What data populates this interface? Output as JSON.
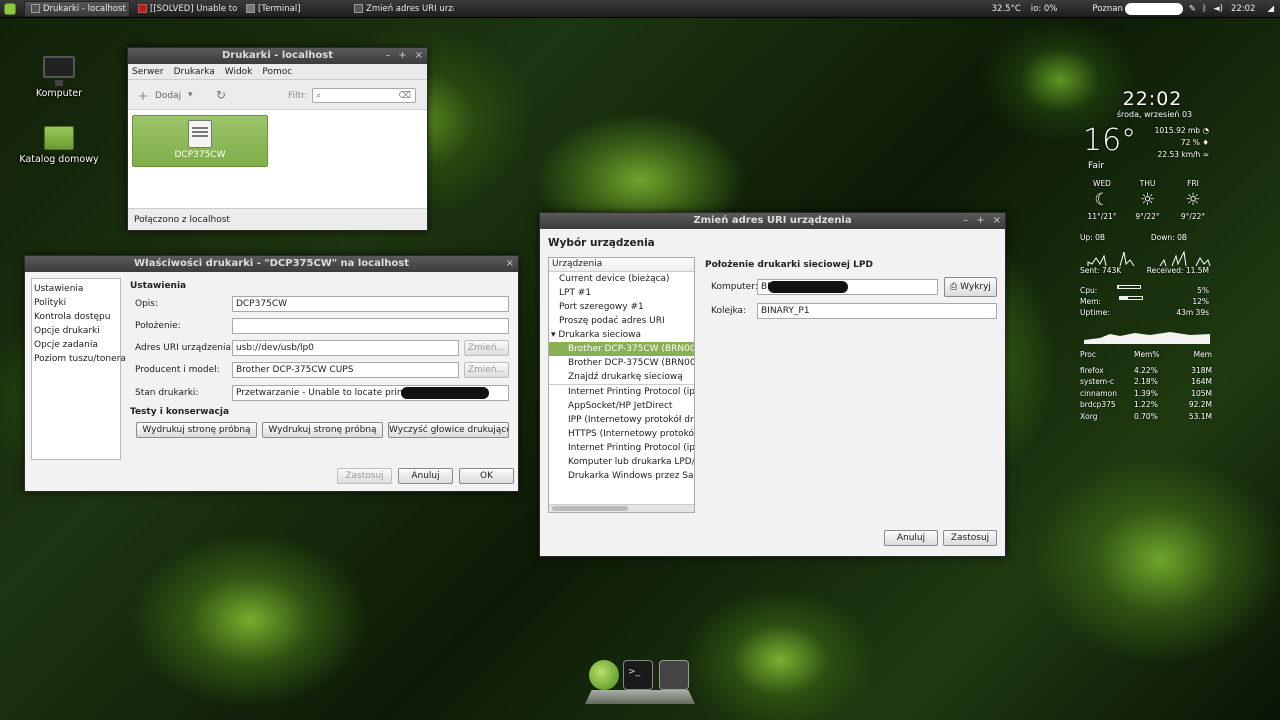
{
  "panel": {
    "tasks": [
      {
        "label": "Drukarki - localhost",
        "active": true
      },
      {
        "label": "[[SOLVED] Unable to ..."
      },
      {
        "label": "[Terminal]"
      },
      {
        "label": "Zmień adres URI urzą..."
      }
    ],
    "temp": "32.5°C",
    "io": "io: 0%",
    "city": "Poznan",
    "time": "22:02"
  },
  "desktop": {
    "computer_label": "Komputer",
    "home_label": "Katalog domowy"
  },
  "printers_window": {
    "title": "Drukarki - localhost",
    "menu": [
      "Serwer",
      "Drukarka",
      "Widok",
      "Pomoc"
    ],
    "add_label": "Dodaj",
    "filter_label": "Filtr:",
    "printer_name": "DCP375CW",
    "status": "Połączono z localhost"
  },
  "props_window": {
    "title": "Właściwości drukarki - \"DCP375CW\" na localhost",
    "sidebar": [
      "Ustawienia",
      "Polityki",
      "Kontrola dostępu",
      "Opcje drukarki",
      "Opcje zadania",
      "Poziom tuszu/tonera"
    ],
    "section_settings": "Ustawienia",
    "desc_label": "Opis:",
    "desc_value": "DCP375CW",
    "location_label": "Położenie:",
    "location_value": "",
    "uri_label": "Adres URI urządzenia:",
    "uri_value": "usb://dev/usb/lp0",
    "change_label": "Zmień...",
    "model_label": "Producent i model:",
    "model_value": "Brother DCP-375CW CUPS",
    "state_label": "Stan drukarki:",
    "state_value": "Przetwarzanie - Unable to locate printer \"",
    "section_tests": "Testy i konserwacja",
    "test_btn": "Wydrukuj stronę próbną",
    "clean_btn": "Wyczyść głowice drukujące",
    "apply": "Zastosuj",
    "cancel": "Anuluj",
    "ok": "OK"
  },
  "uri_window": {
    "title": "Zmień adres URI urządzenia",
    "heading": "Wybór urządzenia",
    "list_header": "Urządzenia",
    "items": [
      {
        "label": "Current device (bieżąca)",
        "indent": 1
      },
      {
        "label": "LPT #1",
        "indent": 1
      },
      {
        "label": "Port szeregowy #1",
        "indent": 1
      },
      {
        "label": "Proszę podać adres URI",
        "indent": 1
      },
      {
        "label": "Drukarka sieciowa",
        "indent": 0,
        "expander": true
      },
      {
        "label": "Brother DCP-375CW (BRN001B",
        "indent": 2,
        "selected": true
      },
      {
        "label": "Brother DCP-375CW (BRN001B",
        "indent": 2
      },
      {
        "label": "Znajdź drukarkę sieciową",
        "indent": 2
      },
      {
        "label": "Internet Printing Protocol (ipps",
        "indent": 2
      },
      {
        "label": "AppSocket/HP JetDirect",
        "indent": 2
      },
      {
        "label": "IPP (Internetowy protokół druk",
        "indent": 2
      },
      {
        "label": "HTTPS (Internetowy protokół dr",
        "indent": 2
      },
      {
        "label": "Internet Printing Protocol (ipp1",
        "indent": 2
      },
      {
        "label": "Komputer lub drukarka LPD/LP",
        "indent": 2
      },
      {
        "label": "Drukarka Windows przez Samb",
        "indent": 2
      }
    ],
    "detail_title": "Położenie drukarki sieciowej LPD",
    "host_label": "Komputer:",
    "host_value": "BR",
    "probe_btn": "Wykryj",
    "queue_label": "Kolejka:",
    "queue_value": "BINARY_P1",
    "cancel": "Anuluj",
    "apply": "Zastosuj"
  },
  "conky": {
    "clock": "22:02",
    "date": "środa, wrzesień 03",
    "temp": "16°",
    "condition": "Fair",
    "pressure": "1015.92 mb",
    "humidity": "72 %",
    "wind": "22.53 km/h",
    "forecast": [
      {
        "day": "WED",
        "range": "11°/21°",
        "icon": "moon-icon"
      },
      {
        "day": "THU",
        "range": "9°/22°",
        "icon": "sun-icon"
      },
      {
        "day": "FRI",
        "range": "9°/22°",
        "icon": "sun-icon"
      }
    ],
    "up_label": "Up: 0B",
    "down_label": "Down: 0B",
    "sent": "Sent: 743K",
    "received": "Received: 11.5M",
    "cpu_label": "Cpu:",
    "cpu_value": "5%",
    "cpu_fraction": 0.05,
    "mem_label": "Mem:",
    "mem_value": "12%",
    "mem_fraction": 0.12,
    "uptime_label": "Uptime:",
    "uptime_value": "43m 39s",
    "proc_headers": [
      "Proc",
      "Mem%",
      "Mem"
    ],
    "procs": [
      [
        "firefox",
        "4.22%",
        "318M"
      ],
      [
        "system-c",
        "2.18%",
        "164M"
      ],
      [
        "cinnamon",
        "1.39%",
        "105M"
      ],
      [
        "brdcp375",
        "1.22%",
        "92.2M"
      ],
      [
        "Xorg",
        "0.70%",
        "53.1M"
      ]
    ]
  }
}
